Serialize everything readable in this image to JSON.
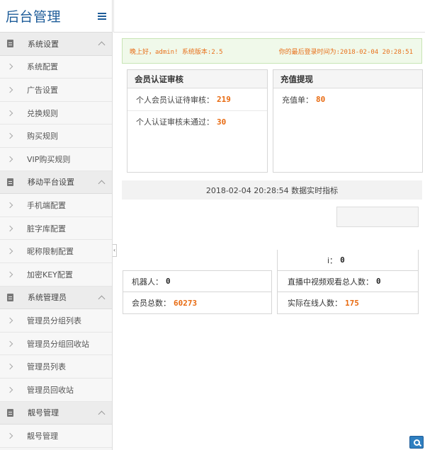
{
  "app": {
    "title": "后台管理"
  },
  "sidebar": {
    "groups": [
      {
        "label": "系统设置",
        "items": [
          "系统配置",
          "广告设置",
          "兑换规则",
          "购买规则",
          "VIP购买规则"
        ]
      },
      {
        "label": "移动平台设置",
        "items": [
          "手机端配置",
          "脏字库配置",
          "昵称限制配置",
          "加密KEY配置"
        ]
      },
      {
        "label": "系统管理员",
        "items": [
          "管理员分组列表",
          "管理员分组回收站",
          "管理员列表",
          "管理员回收站"
        ]
      },
      {
        "label": "靓号管理",
        "items": [
          "靓号管理"
        ]
      }
    ]
  },
  "notice": {
    "greeting": "晚上好，admin! 系统版本:2.5",
    "last_login": "你的最后登录时间为:2018-02-04 20:28:51"
  },
  "member_panel": {
    "title": "会员认证审核",
    "pending_label": "个人会员认证待审核：",
    "pending_value": "219",
    "rejected_label": "个人认证审核未通过：",
    "rejected_value": "30"
  },
  "recharge_panel": {
    "title": "充值提现",
    "recharge_label": "充值单：",
    "recharge_value": "80"
  },
  "stats": {
    "header": "2018-02-04 20:28:54 数据实时指标",
    "partial_label": "i：",
    "partial_value": "0",
    "robots_label": "机器人：",
    "robots_value": "0",
    "live_viewers_label": "直播中视频观看总人数：",
    "live_viewers_value": "0",
    "members_label": "会员总数：",
    "members_value": "60273",
    "online_label": "实际在线人数：",
    "online_value": "175"
  },
  "colors": {
    "brand": "#1d5c99",
    "accent_number": "#e86a10",
    "notice_bg": "#f0f9ea"
  },
  "icons": {
    "menu": "hamburger-icon",
    "group": "document-icon",
    "collapse": "chevron-up-icon",
    "item": "chevron-right-icon",
    "float_button": "search-icon"
  }
}
